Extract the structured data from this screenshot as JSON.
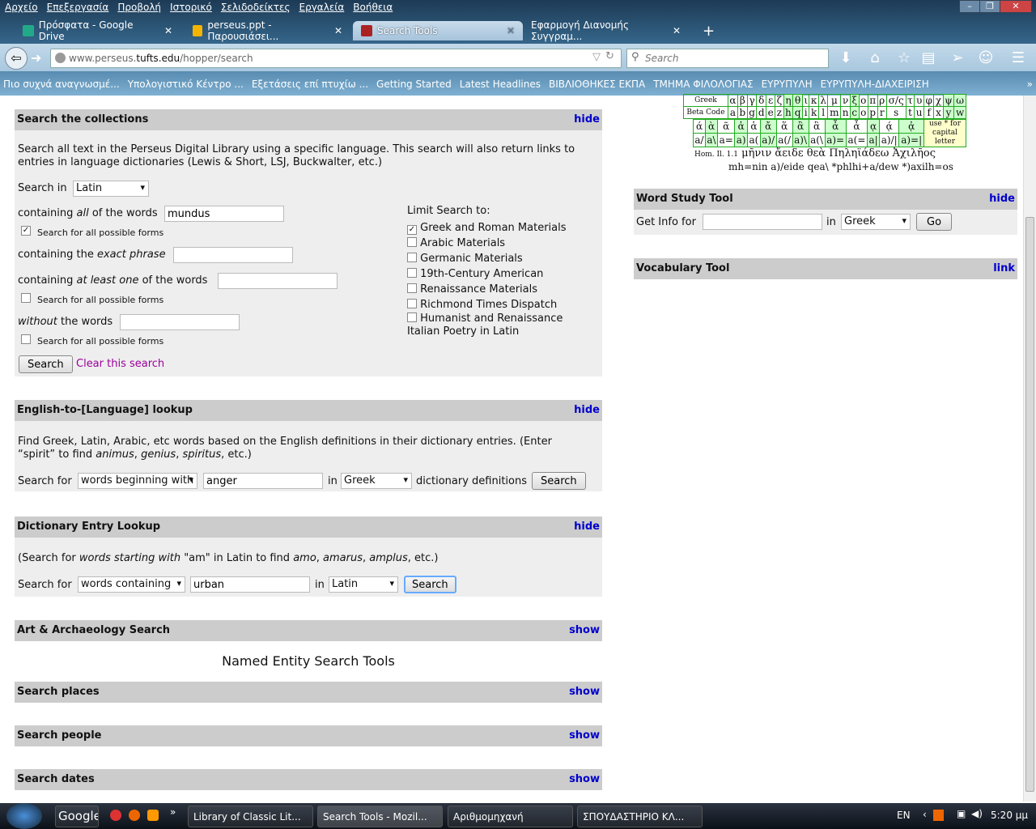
{
  "browser": {
    "menu": [
      "Αρχείο",
      "Επεξεργασία",
      "Προβολή",
      "Ιστορικό",
      "Σελιδοδείκτες",
      "Εργαλεία",
      "Βοήθεια"
    ],
    "tabs": [
      {
        "label": "Πρόσφατα - Google Drive"
      },
      {
        "label": "perseus.ppt - Παρουσιάσει..."
      },
      {
        "label": "Search Tools",
        "active": true
      },
      {
        "label": "Εφαρμογή Διανομής Συγγραμ..."
      }
    ],
    "new_tab": "+",
    "url_prefix": "www.perseus.",
    "url_domain": "tufts.edu",
    "url_path": "/hopper/search",
    "search_placeholder": "Search",
    "bookmarks": [
      "Πιο συχνά αναγνωσμέ...",
      "Υπολογιστικό Κέντρο ...",
      "Εξετάσεις επί πτυχίω ...",
      "Getting Started",
      "Latest Headlines",
      "ΒΙΒΛΙΟΘΗΚΕΣ ΕΚΠΑ",
      "ΤΜΗΜΑ ΦΙΛΟΛΟΓΙΑΣ",
      "ΕΥΡΥΠΥΛΗ",
      "ΕΥΡΥΠΥΛΗ-ΔΙΑΧΕΙΡΙΣΗ"
    ],
    "bookmarks_more": "»"
  },
  "collections": {
    "title": "Search the collections",
    "toggle": "hide",
    "desc": "Search all text in the Perseus Digital Library using a specific language. This search will also return links to entries in language dictionaries (Lewis & Short, LSJ, Buckwalter, etc.)",
    "search_in_label": "Search in",
    "language": "Latin",
    "all_words_pre": "containing ",
    "all_words_em": "all",
    "all_words_post": " of the words",
    "all_words_value": "mundus",
    "forms_label": "Search for all possible forms",
    "phrase_pre": "containing the ",
    "phrase_em": "exact phrase",
    "least_pre": "containing ",
    "least_em": "at least one",
    "least_post": " of the words",
    "without_em": "without",
    "without_post": " the words",
    "forms_checked": [
      true,
      false,
      false
    ],
    "search_button": "Search",
    "clear_link": "Clear this search",
    "limit_label": "Limit Search to:",
    "limits": [
      {
        "label": "Greek and Roman Materials",
        "checked": true
      },
      {
        "label": "Arabic Materials",
        "checked": false
      },
      {
        "label": "Germanic Materials",
        "checked": false
      },
      {
        "label": "19th-Century American",
        "checked": false
      },
      {
        "label": "Renaissance Materials",
        "checked": false
      },
      {
        "label": "Richmond Times Dispatch",
        "checked": false
      },
      {
        "label": "Humanist and Renaissance Italian Poetry in Latin",
        "checked": false
      }
    ]
  },
  "english": {
    "title": "English-to-[Language] lookup",
    "toggle": "hide",
    "desc_pre": "Find Greek, Latin, Arabic, etc words based on the English definitions in their dictionary entries. (Enter “spirit” to find ",
    "e1": "animus",
    "c1": ", ",
    "e2": "genius",
    "c2": ", ",
    "e3": "spiritus",
    "desc_post": ", etc.)",
    "search_for": "Search for",
    "mode": "words beginning with",
    "value": "anger",
    "in": "in",
    "language": "Greek",
    "suffix": "dictionary definitions",
    "button": "Search"
  },
  "dictionary": {
    "title": "Dictionary Entry Lookup",
    "toggle": "hide",
    "d1": "(Search for ",
    "d2": "words starting with",
    "d3": " \"am\" in Latin to find ",
    "d4": "amo",
    "d5": ", ",
    "d6": "amarus",
    "d7": ", ",
    "d8": "amplus",
    "d9": ", etc.)",
    "search_for": "Search for",
    "mode": "words containing",
    "value": "urban",
    "in": "in",
    "language": "Latin",
    "button": "Search"
  },
  "art": {
    "title": "Art & Archaeology Search",
    "toggle": "show"
  },
  "named_entity_title": "Named Entity Search Tools",
  "places": {
    "title": "Search places",
    "toggle": "show"
  },
  "people": {
    "title": "Search people",
    "toggle": "show"
  },
  "dates": {
    "title": "Search dates",
    "toggle": "show"
  },
  "greek_table": {
    "row1_label": "Greek",
    "row1": [
      "α",
      "β",
      "γ",
      "δ",
      "ε",
      "ζ",
      "η",
      "θ",
      "ι",
      "κ",
      "λ",
      "μ",
      "ν",
      "ξ",
      "ο",
      "π",
      "ρ",
      "σ/ς",
      "τ",
      "υ",
      "φ",
      "χ",
      "ψ",
      "ω"
    ],
    "row2_label": "Beta Code",
    "row2": [
      "a",
      "b",
      "g",
      "d",
      "e",
      "z",
      "h",
      "q",
      "i",
      "k",
      "l",
      "m",
      "n",
      "c",
      "o",
      "p",
      "r",
      "s",
      "t",
      "u",
      "f",
      "x",
      "y",
      "w"
    ],
    "row3": [
      "ά",
      "ὰ",
      "ᾶ",
      "ἀ",
      "ἁ",
      "ἄ",
      "ἅ",
      "ἂ",
      "ἃ",
      "ἆ",
      "ἇ",
      "ᾳ",
      "ᾴ",
      "ᾀ"
    ],
    "row4": [
      "a/",
      "a\\",
      "a=",
      "a)",
      "a(",
      "a)/",
      "a(/",
      "a)\\",
      "a(\\",
      "a)=",
      "a(=",
      "a|",
      "a)/|",
      "a)=|"
    ],
    "capital_note": "use * for capital letter",
    "example_ref": "Hom. Il. 1.1",
    "example_greek": "μῆνιν ἄειδε θεὰ Πηληϊάδεω Ἀχιλῆος",
    "example_beta": "mh=nin a)/eide qea\\ *phlhi+a/dew *)axilh=os"
  },
  "word_study": {
    "title": "Word Study Tool",
    "toggle": "hide",
    "get_info": "Get Info for",
    "in": "in",
    "language": "Greek",
    "button": "Go"
  },
  "vocabulary": {
    "title": "Vocabulary Tool",
    "toggle": "link"
  },
  "taskbar": {
    "items": [
      "Google",
      "Library of Classic Lit...",
      "Search Tools - Mozil...",
      "Αριθμομηχανή",
      "ΣΠΟΥΔΑΣΤΗΡΙΟ ΚΛ..."
    ],
    "lang": "EN",
    "time": "5:20 μμ",
    "more": "»"
  }
}
